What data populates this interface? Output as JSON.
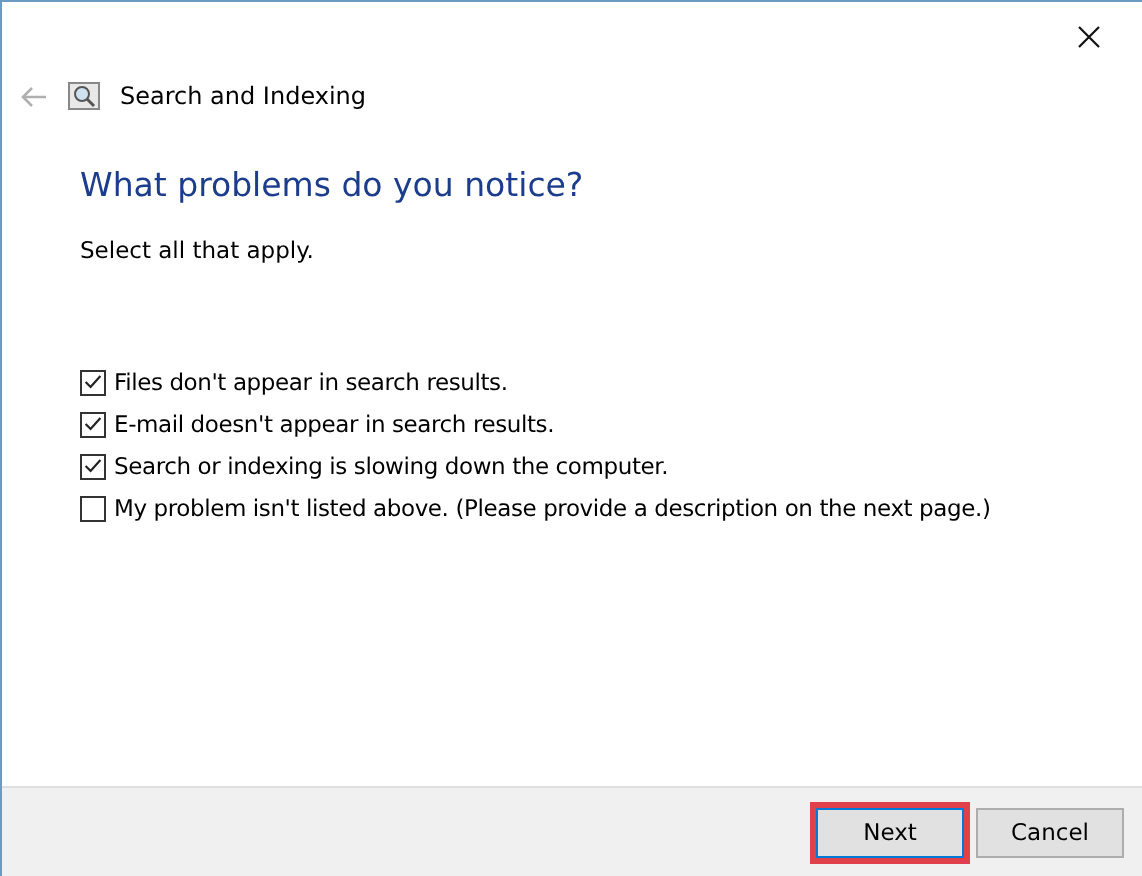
{
  "window": {
    "title": "Search and Indexing"
  },
  "heading": "What problems do you notice?",
  "instruction": "Select all that apply.",
  "options": [
    {
      "label": "Files don't appear in search results.",
      "checked": true
    },
    {
      "label": "E-mail doesn't appear in search results.",
      "checked": true
    },
    {
      "label": "Search or indexing is slowing down the computer.",
      "checked": true
    },
    {
      "label": "My problem isn't listed above. (Please provide a description on the next page.)",
      "checked": false
    }
  ],
  "buttons": [
    {
      "label": "Next",
      "highlighted": true
    },
    {
      "label": "Cancel",
      "highlighted": false
    }
  ]
}
